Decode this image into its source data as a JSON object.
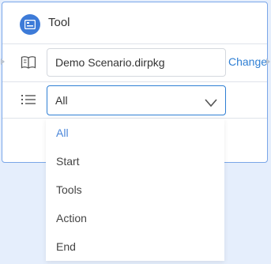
{
  "node": {
    "title": "Tool",
    "source_file": "Demo Scenario.dirpkg",
    "change_label": "Change",
    "filter_selected": "All"
  },
  "dropdown": {
    "options": [
      "All",
      "Start",
      "Tools",
      "Action",
      "End"
    ],
    "selected_index": 0
  },
  "colors": {
    "accent": "#3d7bd8",
    "link": "#2f7fd4",
    "active_option": "#4a86d9",
    "border": "#7aa6e8",
    "background": "#e5eefc"
  },
  "icons": [
    "tool-node-icon",
    "book-icon",
    "list-icon",
    "chevron-down-icon"
  ]
}
